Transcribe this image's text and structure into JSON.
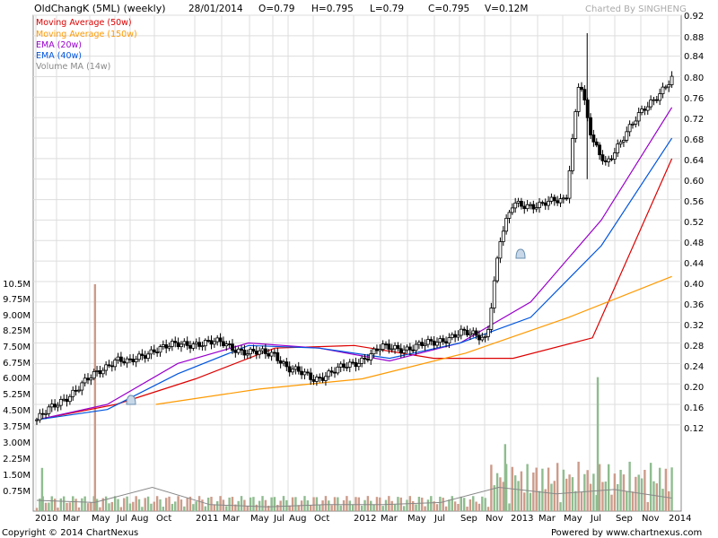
{
  "header": {
    "title": "OldChangK (5ML) (weekly)",
    "date": "28/01/2014",
    "open": "O=0.79",
    "high": "H=0.795",
    "low": "L=0.79",
    "close": "C=0.795",
    "volume": "V=0.12M",
    "charted_by": "Charted By SINGHENG"
  },
  "legend": [
    {
      "label": "Moving Average (50w)",
      "color": "#dd0000"
    },
    {
      "label": "Moving Average (150w)",
      "color": "#ff9900"
    },
    {
      "label": "EMA (20w)",
      "color": "#9900cc"
    },
    {
      "label": "EMA (40w)",
      "color": "#0055dd"
    },
    {
      "label": "Volume MA (14w)",
      "color": "#888888"
    }
  ],
  "footer": {
    "copyright": "Copyright © 2014 ChartNexus",
    "powered": "Powered by www.chartnexus.com"
  },
  "colors": {
    "candle": "#000000",
    "volume_up": "#8fbc8f",
    "volume_down": "#cd9b8a",
    "grid": "#dddddd",
    "alert_icon": "#6a8fb0"
  },
  "icons": [
    "bell-icon",
    "bell-icon"
  ],
  "chart_data": {
    "type": "candlestick",
    "price_axis": {
      "side": "right",
      "ticks": [
        "0.92",
        "0.88",
        "0.84",
        "0.80",
        "0.76",
        "0.72",
        "0.68",
        "0.64",
        "0.60",
        "0.56",
        "0.52",
        "0.48",
        "0.44",
        "0.40",
        "0.36",
        "0.32",
        "0.28",
        "0.24",
        "0.20",
        "0.16",
        "0.12"
      ],
      "range": [
        0.09,
        0.92
      ]
    },
    "volume_axis": {
      "side": "left",
      "ticks": [
        "10.5M",
        "9.75M",
        "9.00M",
        "8.25M",
        "7.50M",
        "6.75M",
        "6.00M",
        "5.25M",
        "4.50M",
        "3.75M",
        "3.00M",
        "2.25M",
        "1.50M",
        "0.75M"
      ]
    },
    "x_labels": [
      "2010",
      "Mar",
      "May",
      "Jul",
      "Aug",
      "Oct",
      "2011",
      "Mar",
      "May",
      "Jul",
      "Aug",
      "Oct",
      "2012",
      "Mar",
      "May",
      "Jul",
      "Sep",
      "Nov",
      "2013",
      "Mar",
      "May",
      "Jul",
      "Sep",
      "Nov",
      "2014"
    ],
    "grid": true,
    "price_key_points": [
      {
        "date": "2010-01",
        "close": 0.13
      },
      {
        "date": "2010-03",
        "close": 0.17
      },
      {
        "date": "2010-05",
        "close": 0.21
      },
      {
        "date": "2010-07",
        "close": 0.25
      },
      {
        "date": "2010-08",
        "close": 0.24
      },
      {
        "date": "2010-10",
        "close": 0.27
      },
      {
        "date": "2011-01",
        "close": 0.28
      },
      {
        "date": "2011-03",
        "close": 0.28
      },
      {
        "date": "2011-05",
        "close": 0.26
      },
      {
        "date": "2011-07",
        "close": 0.26
      },
      {
        "date": "2011-08",
        "close": 0.23
      },
      {
        "date": "2011-10",
        "close": 0.21
      },
      {
        "date": "2012-01",
        "close": 0.24
      },
      {
        "date": "2012-03",
        "close": 0.27
      },
      {
        "date": "2012-05",
        "close": 0.27
      },
      {
        "date": "2012-07",
        "close": 0.28
      },
      {
        "date": "2012-09",
        "close": 0.3
      },
      {
        "date": "2012-11",
        "close": 0.29
      },
      {
        "date": "2012-12",
        "close": 0.48
      },
      {
        "date": "2013-01",
        "close": 0.55
      },
      {
        "date": "2013-03",
        "close": 0.55
      },
      {
        "date": "2013-05",
        "close": 0.56
      },
      {
        "date": "2013-06",
        "close": 0.8
      },
      {
        "date": "2013-07",
        "close": 0.67
      },
      {
        "date": "2013-08",
        "close": 0.63
      },
      {
        "date": "2013-09",
        "close": 0.67
      },
      {
        "date": "2013-11",
        "close": 0.74
      },
      {
        "date": "2014-01",
        "close": 0.795
      }
    ],
    "series": [
      {
        "name": "Moving Average (50w)",
        "values": [
          0.13,
          0.16,
          0.21,
          0.27,
          0.275,
          0.25,
          0.25,
          0.29,
          0.64
        ]
      },
      {
        "name": "Moving Average (150w)",
        "values": [
          0.16,
          0.19,
          0.21,
          0.26,
          0.33,
          0.41
        ]
      },
      {
        "name": "EMA (20w)",
        "values": [
          0.13,
          0.16,
          0.24,
          0.28,
          0.27,
          0.245,
          0.28,
          0.36,
          0.52,
          0.74
        ]
      },
      {
        "name": "EMA (40w)",
        "values": [
          0.13,
          0.15,
          0.22,
          0.275,
          0.27,
          0.25,
          0.28,
          0.33,
          0.47,
          0.68
        ]
      },
      {
        "name": "Volume MA (14w)",
        "values": [
          0.5,
          0.4,
          1.1,
          0.3,
          0.2,
          0.3,
          0.3,
          0.4,
          1.1,
          0.8,
          1.0,
          0.6
        ]
      }
    ],
    "volume_spikes": [
      {
        "date": "2010-05",
        "volume": 10.5,
        "direction": "down"
      },
      {
        "date": "2013-07",
        "volume": 6.2,
        "direction": "up"
      },
      {
        "date": "2012-12",
        "volume": 3.1,
        "direction": "up"
      },
      {
        "date": "2010-01",
        "volume": 2.0,
        "direction": "up"
      }
    ]
  }
}
